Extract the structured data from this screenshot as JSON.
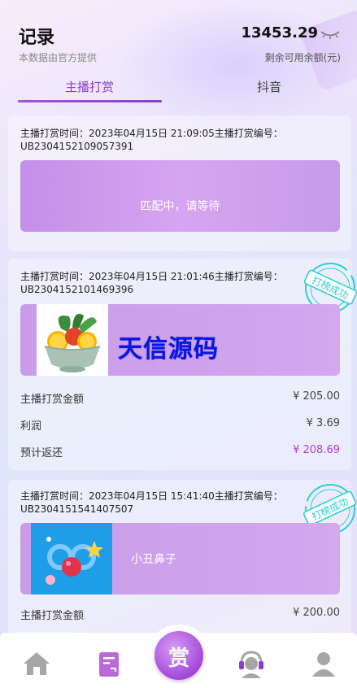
{
  "header": {
    "title": "记录",
    "subtitle": "本数据由官方提供",
    "balance": "13453.29",
    "balance_label": "剩余可用余额(元)"
  },
  "tabs": [
    {
      "label": "主播打赏",
      "active": true
    },
    {
      "label": "抖音",
      "active": false
    }
  ],
  "records": [
    {
      "meta_line1": "主播打赏时间：2023年04月15日 21:09:05主播打赏编号：",
      "meta_line2": "UB2304152109057391",
      "status_text": "匹配中，请等待"
    },
    {
      "meta_line1": "主播打赏时间：2023年04月15日 21:01:46主播打赏编号：",
      "meta_line2": "UB2304152101469396",
      "stamp": "打榜成功",
      "item_image": "fruit-bowl-image",
      "rows": [
        {
          "label": "主播打赏金额",
          "value": "¥ 205.00"
        },
        {
          "label": "利润",
          "value": "¥ 3.69"
        },
        {
          "label": "预计返还",
          "value": "¥ 208.69"
        }
      ]
    },
    {
      "meta_line1": "主播打赏时间：2023年04月15日 15:41:40主播打赏编号：",
      "meta_line2": "UB2304151541407507",
      "stamp": "打榜成功",
      "item_image": "clown-nose-image",
      "item_name": "小丑鼻子",
      "rows": [
        {
          "label": "主播打赏金额",
          "value": "¥ 200.00"
        }
      ]
    }
  ],
  "watermark": "天信源码",
  "bottom_nav": {
    "center_label": "赏",
    "items": [
      "home-icon",
      "record-icon",
      "reward-button",
      "customer-service-icon",
      "user-icon"
    ]
  },
  "colors": {
    "accent": "#8a3fd2",
    "panel": "#c99be9",
    "return_value": "#b03ad3",
    "stamp": "#2ccdd8",
    "watermark": "#0a17e0"
  }
}
